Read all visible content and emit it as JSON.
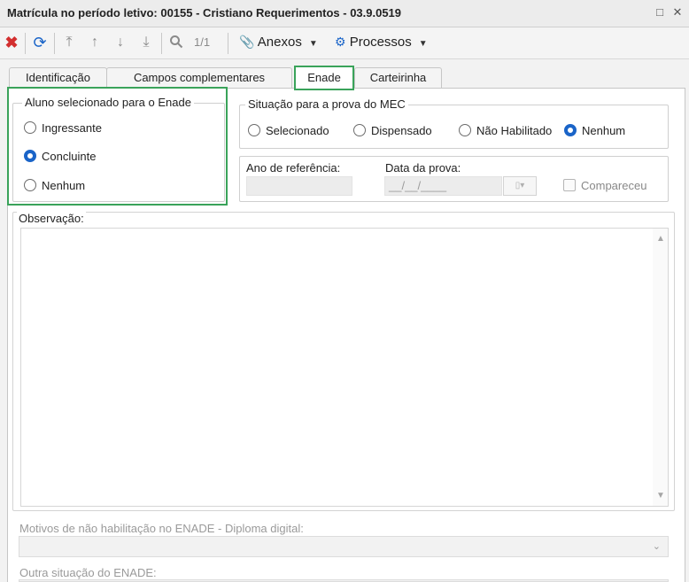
{
  "window": {
    "title": "Matrícula no período letivo: 00155 - Cristiano Requerimentos - 03.9.0519",
    "maximize_icon": "□",
    "close_icon": "✕"
  },
  "toolbar": {
    "page_indicator": "1/1",
    "anexos_label": "Anexos",
    "processos_label": "Processos",
    "delete_color": "#d32f2f",
    "refresh_color": "#1a64c8"
  },
  "tabs": [
    {
      "label": "Identificação"
    },
    {
      "label": "Campos complementares"
    },
    {
      "label": "Enade"
    },
    {
      "label": "Carteirinha"
    }
  ],
  "aluno_group": {
    "legend": "Aluno selecionado para o Enade",
    "options": [
      {
        "label": "Ingressante",
        "selected": false
      },
      {
        "label": "Concluinte",
        "selected": true
      },
      {
        "label": "Nenhum",
        "selected": false
      }
    ]
  },
  "situacao_group": {
    "legend": "Situação para a prova do MEC",
    "options": [
      {
        "label": "Selecionado",
        "selected": false
      },
      {
        "label": "Dispensado",
        "selected": false
      },
      {
        "label": "Não Habilitado",
        "selected": false
      },
      {
        "label": "Nenhum",
        "selected": true
      }
    ]
  },
  "details": {
    "ano_label": "Ano de referência:",
    "ano_value": "",
    "data_label": "Data da prova:",
    "data_value": "__/__/____",
    "compareceu_label": "Compareceu",
    "compareceu_checked": false
  },
  "observacao": {
    "legend": "Observação:",
    "value": ""
  },
  "motivos": {
    "label": "Motivos de não habilitação no ENADE - Diploma digital:",
    "value": ""
  },
  "outra": {
    "label": "Outra situação do ENADE:"
  },
  "colors": {
    "accent": "#1a64c8",
    "highlight": "#3aa35a"
  }
}
